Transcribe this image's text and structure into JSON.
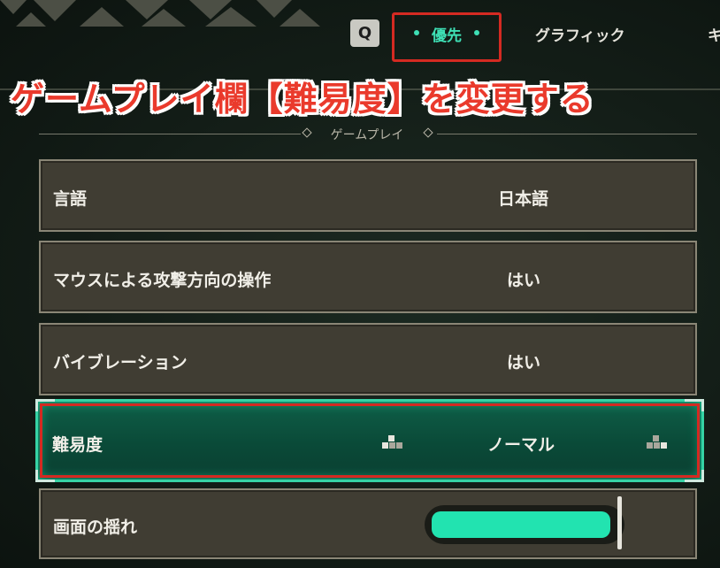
{
  "header": {
    "search_key": "Q",
    "tabs": [
      {
        "label": "優先",
        "active": true
      },
      {
        "label": "グラフィック",
        "active": false
      },
      {
        "label": "キ",
        "active": false
      }
    ]
  },
  "annotation": {
    "text": "ゲームプレイ欄【難易度】を変更する",
    "color": "#ea3a2c"
  },
  "section": {
    "title": "ゲームプレイ"
  },
  "settings": [
    {
      "label": "言語",
      "value": "日本語"
    },
    {
      "label": "マウスによる攻撃方向の操作",
      "value": "はい"
    },
    {
      "label": "バイブレーション",
      "value": "はい"
    },
    {
      "label": "難易度",
      "value": "ノーマル",
      "selected": true
    },
    {
      "label": "画面の揺れ",
      "slider_level": 0.96
    }
  ],
  "colors": {
    "accent": "#3ee0b5",
    "highlight": "#d42a22",
    "row_bg": "#403d33"
  },
  "icons": [
    "search-key-icon",
    "arrow-left-icon",
    "arrow-right-icon"
  ]
}
